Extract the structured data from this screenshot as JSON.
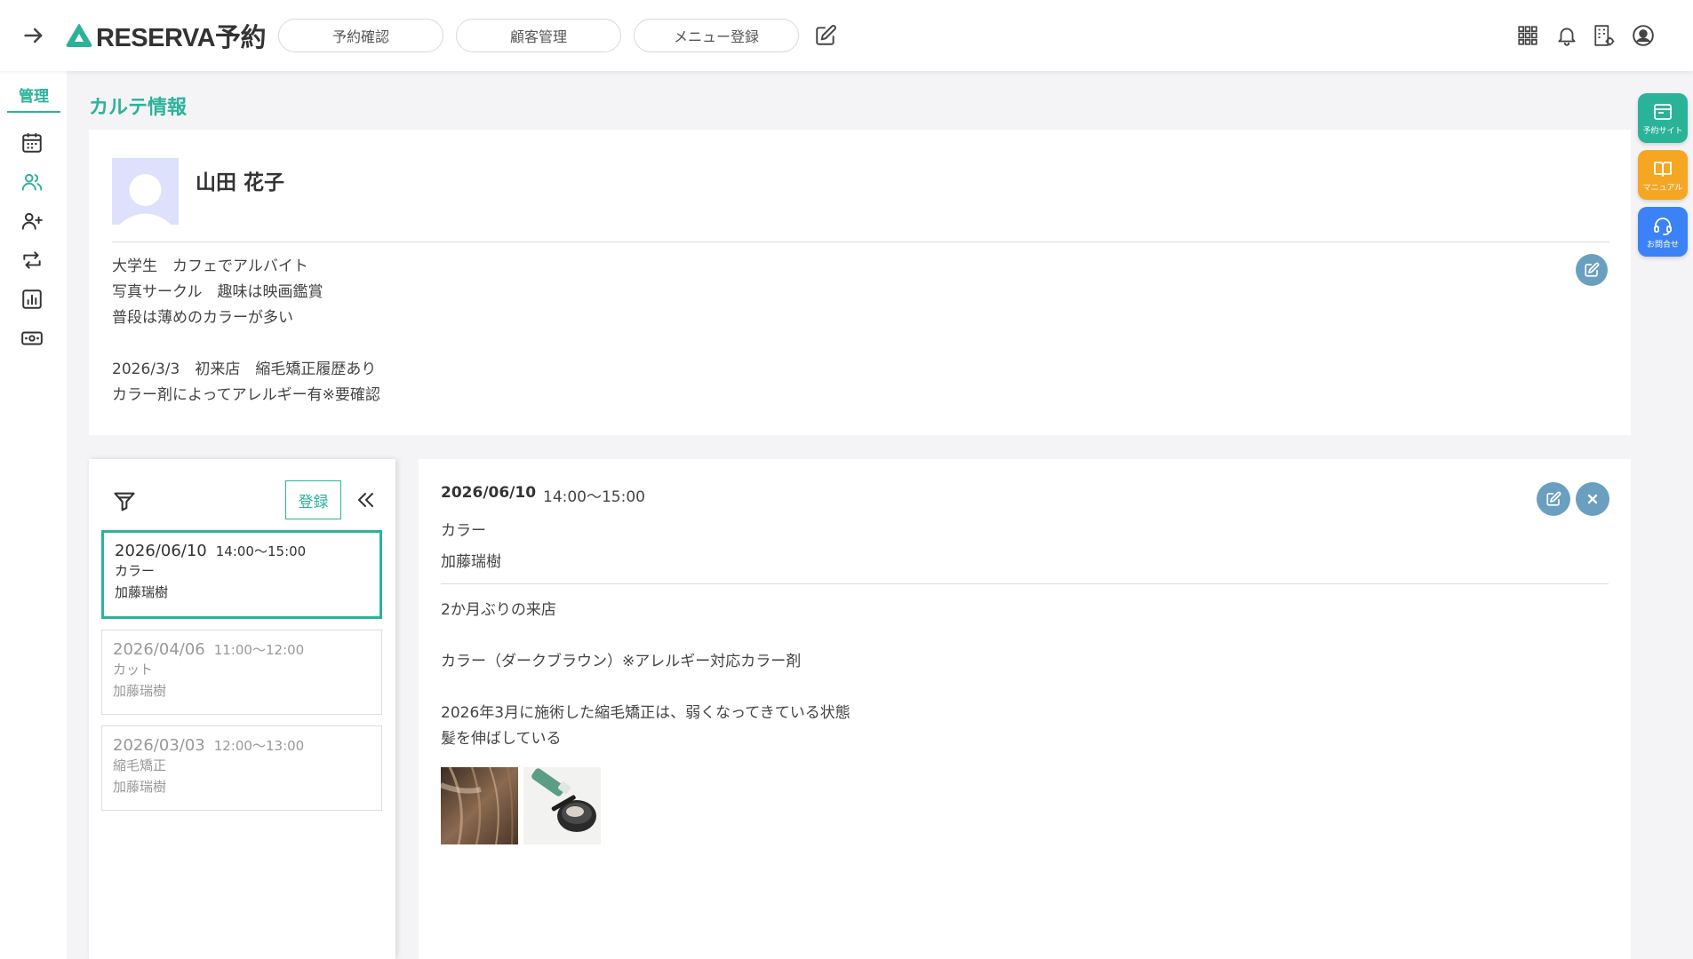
{
  "header": {
    "logo_text": "RESERVA予約",
    "nav": [
      "予約確認",
      "顧客管理",
      "メニュー登録"
    ]
  },
  "sidebar": {
    "title": "管理"
  },
  "floating": {
    "booking_site": "予約サイト",
    "manual": "マニュアル",
    "contact": "お問合せ"
  },
  "page": {
    "title": "カルテ情報"
  },
  "customer": {
    "name": "山田 花子",
    "notes": [
      "大学生　カフェでアルバイト",
      "写真サークル　趣味は映画鑑賞",
      "普段は薄めのカラーが多い",
      "",
      "2026/3/3　初来店　縮毛矯正履歴あり",
      "カラー剤によってアレルギー有※要確認"
    ]
  },
  "history": {
    "register_label": "登録",
    "items": [
      {
        "date": "2026/06/10",
        "time": "14:00〜15:00",
        "menu": "カラー",
        "staff": "加藤瑞樹"
      },
      {
        "date": "2026/04/06",
        "time": "11:00〜12:00",
        "menu": "カット",
        "staff": "加藤瑞樹"
      },
      {
        "date": "2026/03/03",
        "time": "12:00〜13:00",
        "menu": "縮毛矯正",
        "staff": "加藤瑞樹"
      }
    ]
  },
  "detail": {
    "date": "2026/06/10",
    "time": "14:00〜15:00",
    "menu": "カラー",
    "staff": "加藤瑞樹",
    "notes": [
      "2か月ぶりの来店",
      "",
      "カラー（ダークブラウン）※アレルギー対応カラー剤",
      "",
      "2026年3月に施術した縮毛矯正は、弱くなってきている状態",
      "髪を伸ばしている"
    ]
  },
  "colors": {
    "accent": "#2bb39a",
    "manual": "#f5a623",
    "contact": "#3b82f6",
    "round_button": "#6a9fc0"
  }
}
